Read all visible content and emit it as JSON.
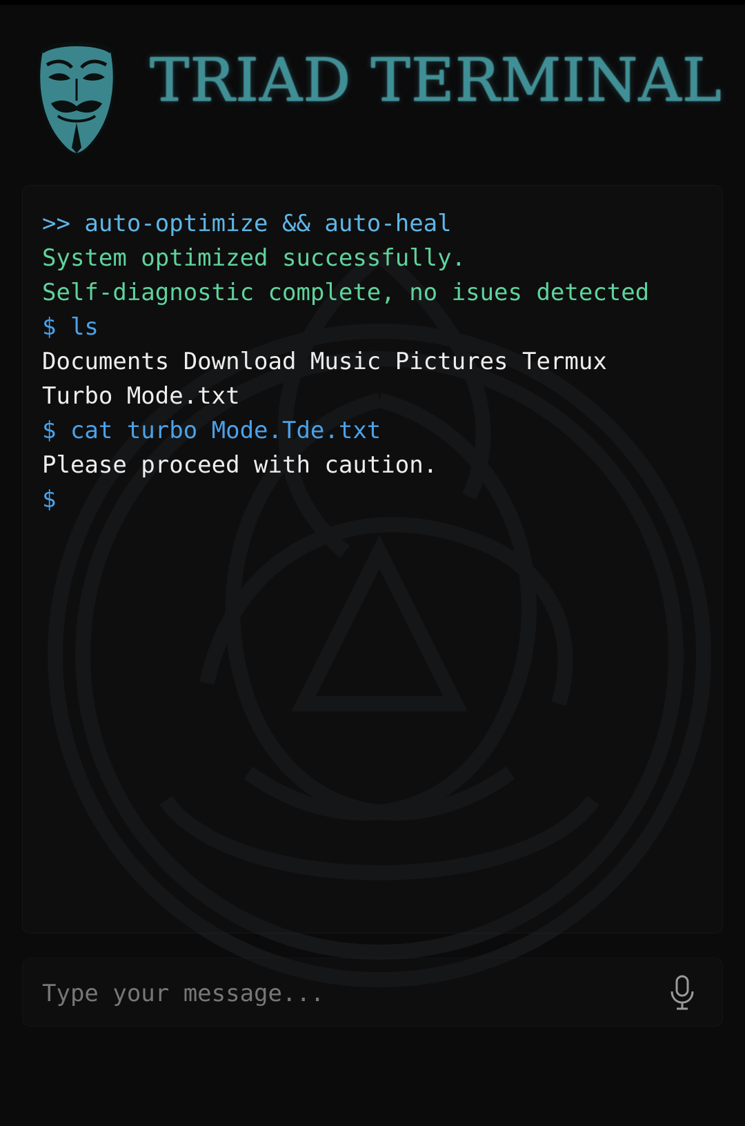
{
  "app": {
    "title": "TRIAD TERMINAL",
    "logo_icon": "guy-fawkes-mask-icon",
    "watermark_icon": "triquetra-watermark-icon"
  },
  "terminal": {
    "lines": [
      {
        "kind": "command",
        "text": ">> auto-optimize && auto-heal"
      },
      {
        "kind": "success",
        "text": "System optimized successfully."
      },
      {
        "kind": "success",
        "text": "Self-diagnostic complete, no isues detected"
      },
      {
        "kind": "command",
        "text": "$ ls"
      },
      {
        "kind": "output",
        "text": "Documents Download Music Pictures Termux"
      },
      {
        "kind": "output",
        "text": "Turbo Mode.txt"
      },
      {
        "kind": "command",
        "text": "$ cat turbo Mode.Tde.txt"
      },
      {
        "kind": "output",
        "text": "Please proceed with caution."
      },
      {
        "kind": "prompt",
        "text": "$"
      }
    ]
  },
  "composer": {
    "placeholder": "Type your message...",
    "value": "",
    "mic_icon": "microphone-icon"
  },
  "colors": {
    "background": "#0b0b0c",
    "title": "#3f8f96",
    "command": "#4ba2e9",
    "success": "#5fd39b",
    "output": "#eeeeee",
    "placeholder": "#777777"
  }
}
